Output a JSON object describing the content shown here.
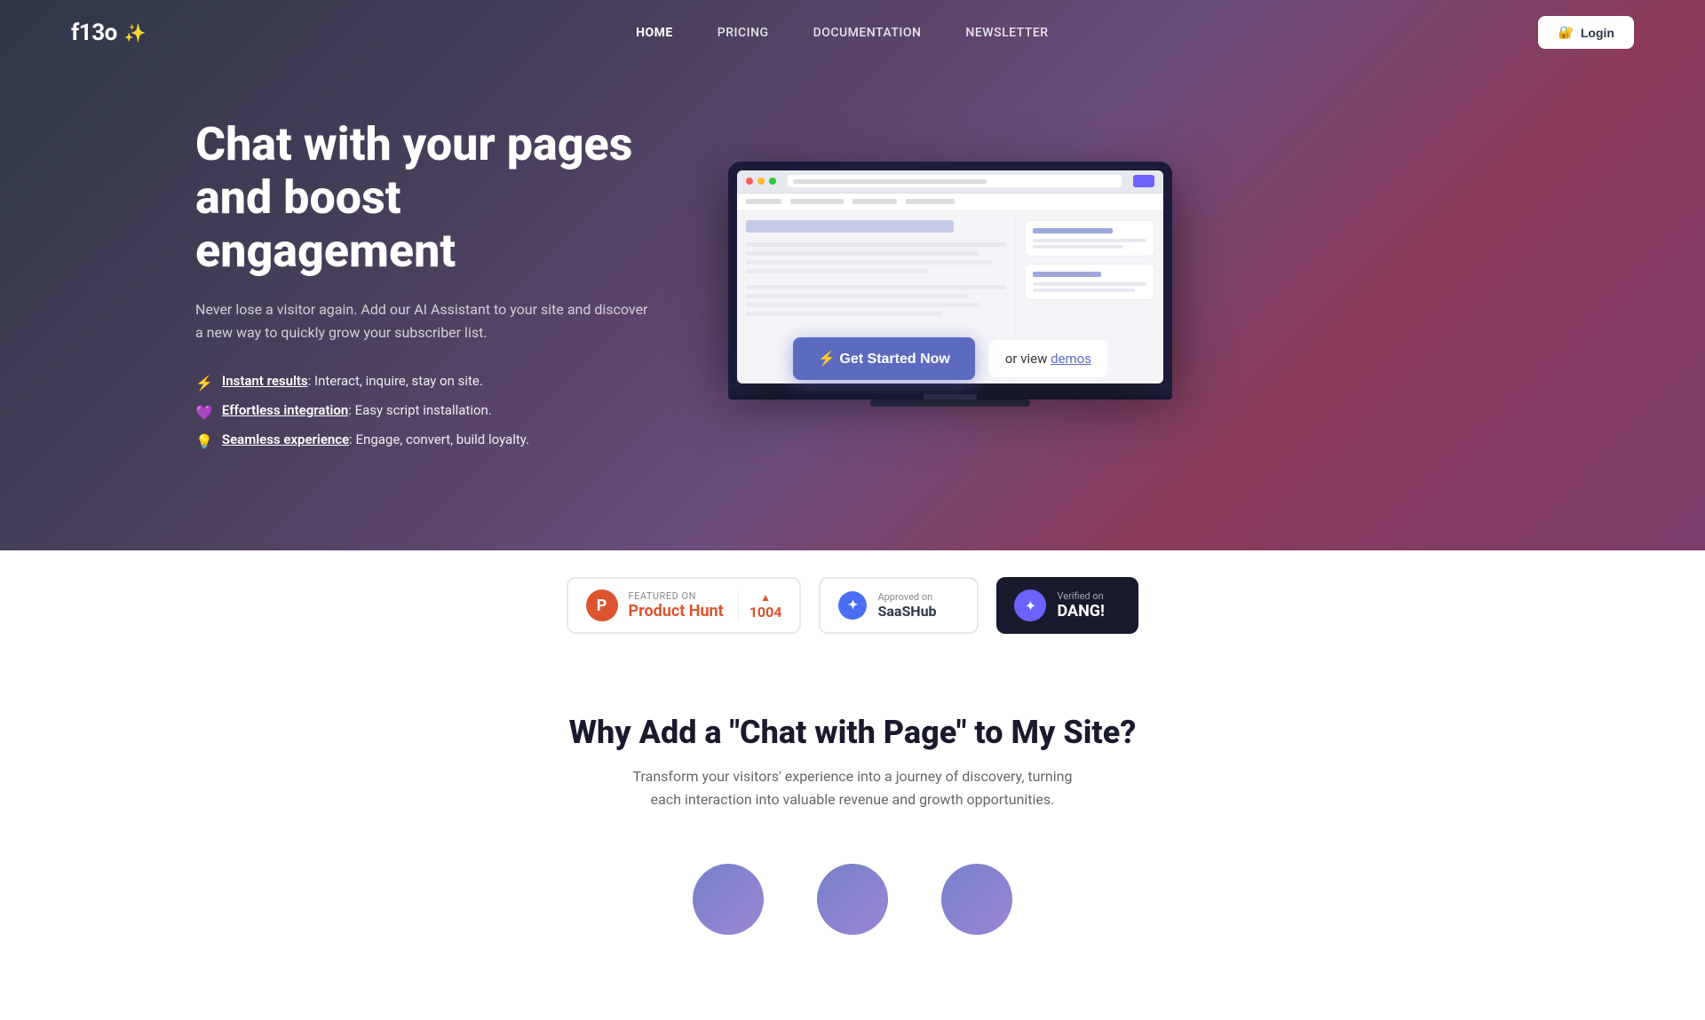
{
  "logo": {
    "text": "f13o",
    "star": "✨"
  },
  "nav": {
    "links": [
      {
        "label": "HOME",
        "active": true,
        "id": "home"
      },
      {
        "label": "PRICING",
        "active": false,
        "id": "pricing"
      },
      {
        "label": "DOCUMENTATION",
        "active": false,
        "id": "documentation"
      },
      {
        "label": "NEWSLETTER",
        "active": false,
        "id": "newsletter"
      }
    ],
    "login_label": "Login",
    "login_icon": "🔐"
  },
  "hero": {
    "title": "Chat with your pages and boost engagement",
    "subtitle": "Never lose a visitor again. Add our AI Assistant to your site and discover a new way to quickly grow your subscriber list.",
    "features": [
      {
        "icon": "⚡",
        "icon_color": "#f6c90e",
        "link_text": "Instant results",
        "description": ": Interact, inquire, stay on site."
      },
      {
        "icon": "💜",
        "icon_color": "#9b59b6",
        "link_text": "Effortless integration",
        "description": ": Easy script installation."
      },
      {
        "icon": "💡",
        "icon_color": "#f9ca24",
        "link_text": "Seamless experience",
        "description": ": Engage, convert, build loyalty."
      }
    ],
    "cta_primary": "⚡ Get Started Now",
    "cta_secondary_prefix": "or view ",
    "cta_secondary_link": "demos"
  },
  "badges": {
    "producthunt": {
      "label": "FEATURED ON",
      "name": "Product Hunt",
      "count": "1004",
      "arrow": "▲"
    },
    "saashub": {
      "label": "Approved on",
      "name": "SaaSHub"
    },
    "dang": {
      "label": "Verified on",
      "name": "DANG!"
    }
  },
  "why": {
    "title": "Why Add a \"Chat with Page\" to My Site?",
    "subtitle": "Transform your visitors' experience into a journey of discovery, turning each interaction into valuable revenue and growth opportunities.",
    "cards": [
      {
        "id": "card-1"
      },
      {
        "id": "card-2"
      },
      {
        "id": "card-3"
      }
    ]
  }
}
